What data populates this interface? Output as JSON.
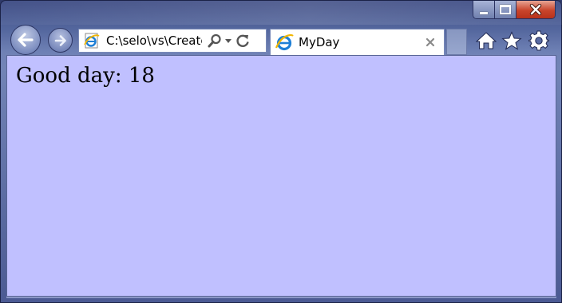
{
  "window": {
    "caption_buttons": [
      "minimize",
      "maximize",
      "close"
    ]
  },
  "navigation": {
    "back_icon": "back-arrow-icon",
    "forward_icon": "forward-arrow-icon"
  },
  "address_bar": {
    "value": "C:\\selo\\vs\\CreateH",
    "page_icon": "ie-page-icon",
    "search_icon": "search-icon",
    "dropdown_icon": "chevron-down-icon",
    "refresh_icon": "refresh-icon"
  },
  "tab": {
    "title": "MyDay",
    "favicon": "ie-icon",
    "close_icon": "close-icon"
  },
  "toolbar": {
    "home_icon": "home-icon",
    "favorites_icon": "star-icon",
    "tools_icon": "gear-icon"
  },
  "page": {
    "background": "#c0c0ff",
    "greeting": "Good day: 18"
  },
  "colors": {
    "close_button": "#c9442b",
    "frame": "#55689f"
  }
}
